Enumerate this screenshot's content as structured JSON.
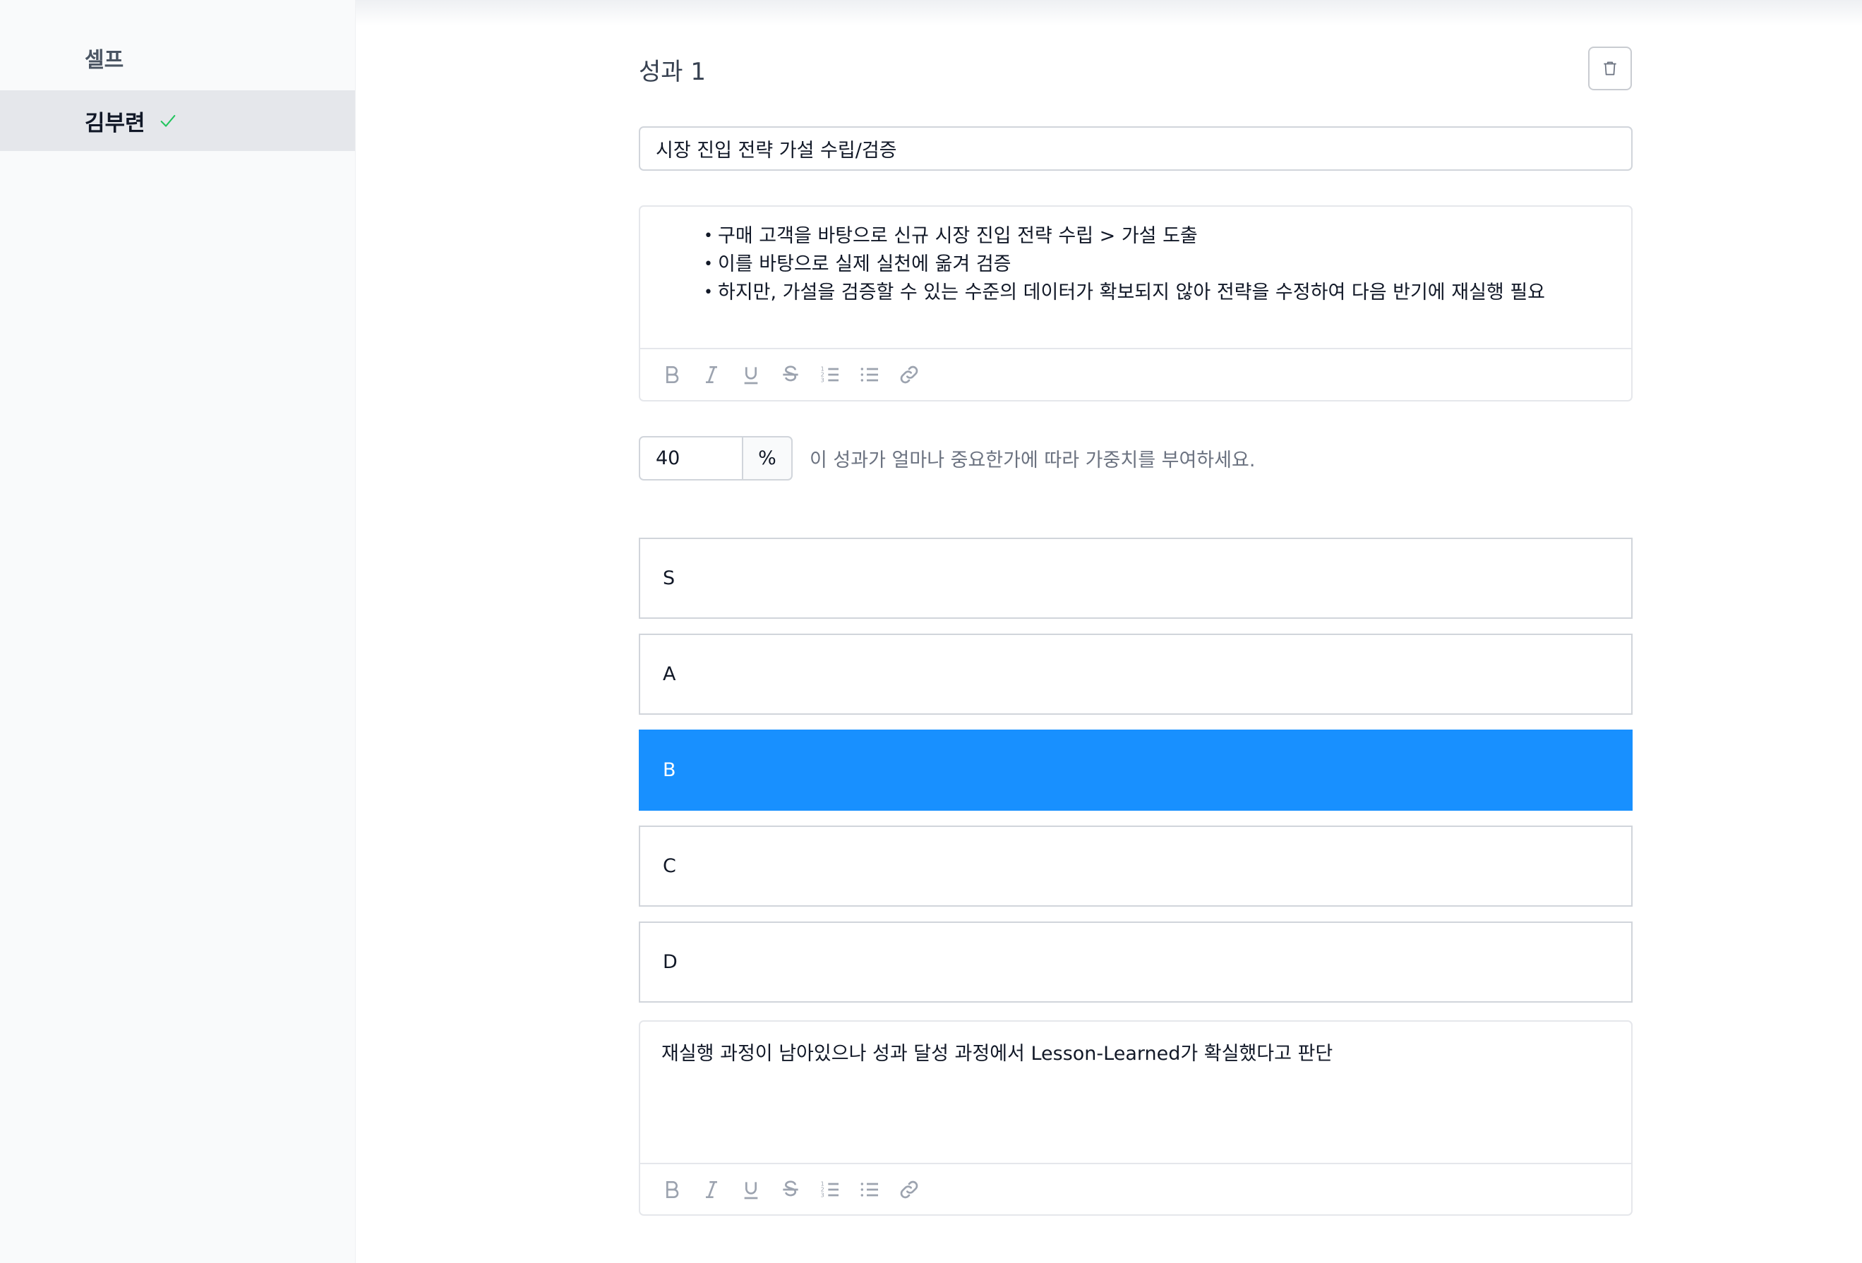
{
  "sidebar": {
    "section_title": "셀프",
    "items": [
      {
        "label": "김부련",
        "status": "completed",
        "status_icon": "checkmark-icon",
        "status_color": "#22c55e"
      }
    ]
  },
  "outcome": {
    "heading": "성과 1",
    "delete_icon": "trash-icon",
    "title_value": "시장 진입 전략 가설 수립/검증",
    "description_bullets": [
      "구매 고객을 바탕으로 신규 시장 진입 전략 수립 > 가설 도출",
      "이를 바탕으로 실제 실천에 옮겨 검증",
      "하지만, 가설을 검증할 수 있는 수준의 데이터가 확보되지 않아 전략을 수정하여 다음 반기에 재실행 필요"
    ],
    "weight": {
      "value": "40",
      "unit": "%",
      "help": "이 성과가 얼마나 중요한가에 따라 가중치를 부여하세요."
    },
    "grades": [
      {
        "label": "S",
        "selected": false
      },
      {
        "label": "A",
        "selected": false
      },
      {
        "label": "B",
        "selected": true
      },
      {
        "label": "C",
        "selected": false
      },
      {
        "label": "D",
        "selected": false
      }
    ],
    "selected_grade_color": "#1890ff",
    "comment": "재실행 과정이 남아있으나 성과 달성 과정에서 Lesson-Learned가 확실했다고 판단"
  },
  "editor_toolbar": {
    "tools": [
      "bold-icon",
      "italic-icon",
      "underline-icon",
      "strikethrough-icon",
      "ordered-list-icon",
      "bullet-list-icon",
      "link-icon"
    ]
  }
}
